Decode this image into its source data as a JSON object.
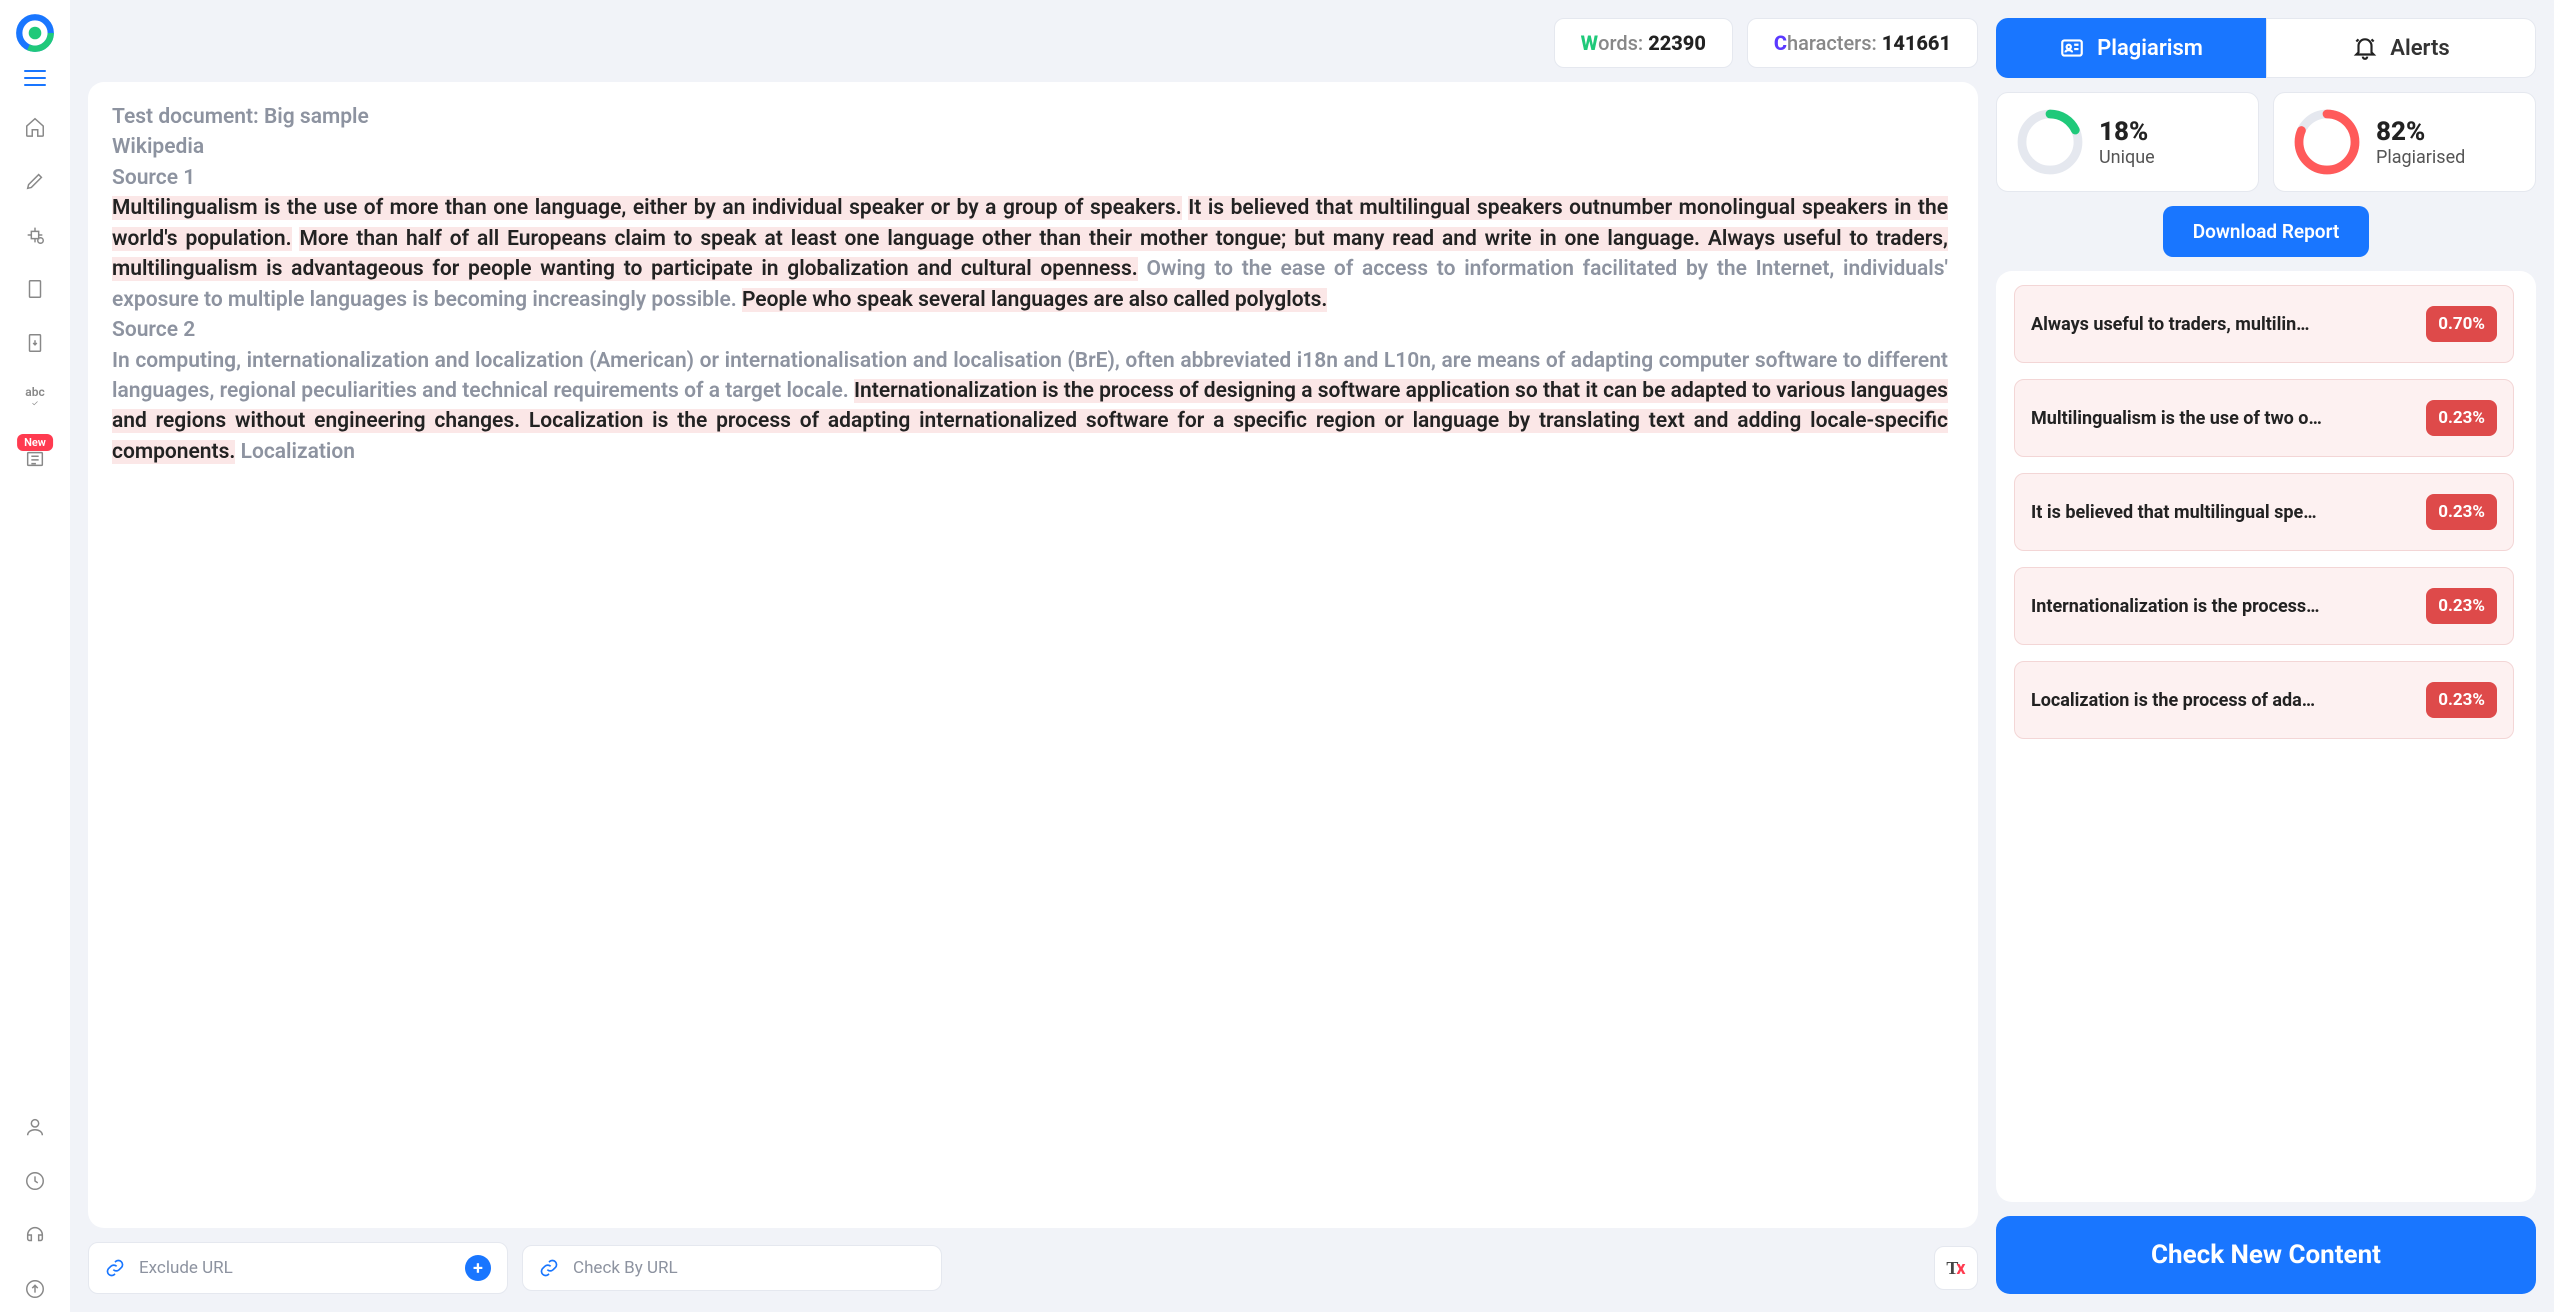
{
  "stats": {
    "words_label": "ords:",
    "words": "22390",
    "chars_label": "haracters:",
    "chars": "141661"
  },
  "tabs": {
    "plagiarism": "Plagiarism",
    "alerts": "Alerts"
  },
  "gauges": {
    "unique_pct": "18%",
    "unique_label": "Unique",
    "unique_val": 18,
    "plag_pct": "82%",
    "plag_label": "Plagiarised",
    "plag_val": 82
  },
  "download": "Download Report",
  "check_new": "Check New Content",
  "exclude_placeholder": "Exclude URL",
  "checkby_placeholder": "Check By URL",
  "new_badge": "New",
  "doc": {
    "title": "Test document: Big sample",
    "sub1": "Wikipedia",
    "src1": "Source 1",
    "p1a": "Multilingualism is the use of more than one language, either by an individual speaker or by a group of speakers.",
    "p1b": "It is believed that multilingual speakers outnumber monolingual speakers in the world's population.",
    "p1c": "More than half of all Europeans claim to speak at least one language other than their mother tongue; but many read and write in one language. Always useful to traders, multilingualism is advantageous for people wanting to participate in globalization and cultural openness.",
    "p1d": "Owing to the ease of access to information facilitated by the Internet, individuals' exposure to multiple languages is becoming increasingly possible.",
    "p1e": "People who speak several languages are also called polyglots.",
    "src2": "Source 2",
    "p2a": "In computing, internationalization and localization (American) or internationalisation and localisation (BrE), often abbreviated i18n and L10n, are means of adapting computer software to different languages, regional peculiarities and technical requirements of a target locale.",
    "p2b": "Internationalization is the process of designing a software application so that it can be adapted to various languages and regions without engineering changes. Localization is the process of adapting internationalized software for a specific region or language by translating text and adding locale-specific components.",
    "p2c": "Localization"
  },
  "matches": [
    {
      "text": "Always useful to traders, multilin…",
      "pct": "0.70%"
    },
    {
      "text": "Multilingualism is the use of two o…",
      "pct": "0.23%"
    },
    {
      "text": "It is believed that multilingual spe…",
      "pct": "0.23%"
    },
    {
      "text": "Internationalization is the process…",
      "pct": "0.23%"
    },
    {
      "text": "Localization is the process of ada…",
      "pct": "0.23%"
    }
  ]
}
